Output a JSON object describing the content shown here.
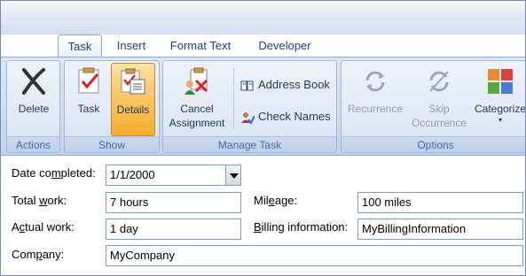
{
  "tabs": [
    "Task",
    "Insert",
    "Format Text",
    "Developer"
  ],
  "groups": {
    "actions": "Actions",
    "show": "Show",
    "manage_task": "Manage Task",
    "options": "Options"
  },
  "buttons": {
    "delete": "Delete",
    "task": "Task",
    "details": "Details",
    "cancel_assignment": [
      "Cancel",
      "Assignment"
    ],
    "address_book": "Address Book",
    "check_names": "Check Names",
    "recurrence": "Recurrence",
    "skip_occurrence": [
      "Skip",
      "Occurrence"
    ],
    "categorize": "Categorize"
  },
  "form": {
    "date_completed": {
      "label_pre": "Date co",
      "label_key": "m",
      "label_post": "pleted:",
      "value": "1/1/2000"
    },
    "total_work": {
      "label_pre": "Total ",
      "label_key": "w",
      "label_post": "ork:",
      "value": "7 hours"
    },
    "actual_work": {
      "label_pre": "A",
      "label_key": "c",
      "label_post": "tual work:",
      "value": "1 day"
    },
    "company": {
      "label_pre": "Com",
      "label_key": "p",
      "label_post": "any:",
      "value": "MyCompany"
    },
    "mileage": {
      "label_pre": "Mil",
      "label_key": "e",
      "label_post": "age:",
      "value": "100 miles"
    },
    "billing": {
      "label_pre": "",
      "label_key": "B",
      "label_post": "illing information:",
      "value": "MyBillingInformation"
    }
  },
  "colors": {
    "accent": "#15428b",
    "pressed": "#f9c765",
    "ribbon": "#cfdcef"
  }
}
